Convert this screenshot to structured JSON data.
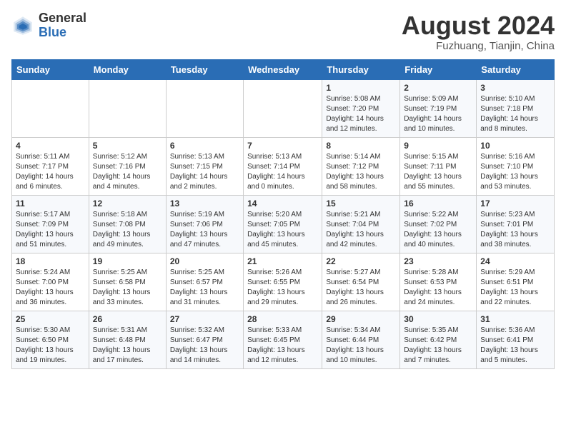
{
  "logo": {
    "general": "General",
    "blue": "Blue"
  },
  "title": {
    "month_year": "August 2024",
    "location": "Fuzhuang, Tianjin, China"
  },
  "headers": [
    "Sunday",
    "Monday",
    "Tuesday",
    "Wednesday",
    "Thursday",
    "Friday",
    "Saturday"
  ],
  "weeks": [
    [
      {
        "day": "",
        "detail": ""
      },
      {
        "day": "",
        "detail": ""
      },
      {
        "day": "",
        "detail": ""
      },
      {
        "day": "",
        "detail": ""
      },
      {
        "day": "1",
        "detail": "Sunrise: 5:08 AM\nSunset: 7:20 PM\nDaylight: 14 hours\nand 12 minutes."
      },
      {
        "day": "2",
        "detail": "Sunrise: 5:09 AM\nSunset: 7:19 PM\nDaylight: 14 hours\nand 10 minutes."
      },
      {
        "day": "3",
        "detail": "Sunrise: 5:10 AM\nSunset: 7:18 PM\nDaylight: 14 hours\nand 8 minutes."
      }
    ],
    [
      {
        "day": "4",
        "detail": "Sunrise: 5:11 AM\nSunset: 7:17 PM\nDaylight: 14 hours\nand 6 minutes."
      },
      {
        "day": "5",
        "detail": "Sunrise: 5:12 AM\nSunset: 7:16 PM\nDaylight: 14 hours\nand 4 minutes."
      },
      {
        "day": "6",
        "detail": "Sunrise: 5:13 AM\nSunset: 7:15 PM\nDaylight: 14 hours\nand 2 minutes."
      },
      {
        "day": "7",
        "detail": "Sunrise: 5:13 AM\nSunset: 7:14 PM\nDaylight: 14 hours\nand 0 minutes."
      },
      {
        "day": "8",
        "detail": "Sunrise: 5:14 AM\nSunset: 7:12 PM\nDaylight: 13 hours\nand 58 minutes."
      },
      {
        "day": "9",
        "detail": "Sunrise: 5:15 AM\nSunset: 7:11 PM\nDaylight: 13 hours\nand 55 minutes."
      },
      {
        "day": "10",
        "detail": "Sunrise: 5:16 AM\nSunset: 7:10 PM\nDaylight: 13 hours\nand 53 minutes."
      }
    ],
    [
      {
        "day": "11",
        "detail": "Sunrise: 5:17 AM\nSunset: 7:09 PM\nDaylight: 13 hours\nand 51 minutes."
      },
      {
        "day": "12",
        "detail": "Sunrise: 5:18 AM\nSunset: 7:08 PM\nDaylight: 13 hours\nand 49 minutes."
      },
      {
        "day": "13",
        "detail": "Sunrise: 5:19 AM\nSunset: 7:06 PM\nDaylight: 13 hours\nand 47 minutes."
      },
      {
        "day": "14",
        "detail": "Sunrise: 5:20 AM\nSunset: 7:05 PM\nDaylight: 13 hours\nand 45 minutes."
      },
      {
        "day": "15",
        "detail": "Sunrise: 5:21 AM\nSunset: 7:04 PM\nDaylight: 13 hours\nand 42 minutes."
      },
      {
        "day": "16",
        "detail": "Sunrise: 5:22 AM\nSunset: 7:02 PM\nDaylight: 13 hours\nand 40 minutes."
      },
      {
        "day": "17",
        "detail": "Sunrise: 5:23 AM\nSunset: 7:01 PM\nDaylight: 13 hours\nand 38 minutes."
      }
    ],
    [
      {
        "day": "18",
        "detail": "Sunrise: 5:24 AM\nSunset: 7:00 PM\nDaylight: 13 hours\nand 36 minutes."
      },
      {
        "day": "19",
        "detail": "Sunrise: 5:25 AM\nSunset: 6:58 PM\nDaylight: 13 hours\nand 33 minutes."
      },
      {
        "day": "20",
        "detail": "Sunrise: 5:25 AM\nSunset: 6:57 PM\nDaylight: 13 hours\nand 31 minutes."
      },
      {
        "day": "21",
        "detail": "Sunrise: 5:26 AM\nSunset: 6:55 PM\nDaylight: 13 hours\nand 29 minutes."
      },
      {
        "day": "22",
        "detail": "Sunrise: 5:27 AM\nSunset: 6:54 PM\nDaylight: 13 hours\nand 26 minutes."
      },
      {
        "day": "23",
        "detail": "Sunrise: 5:28 AM\nSunset: 6:53 PM\nDaylight: 13 hours\nand 24 minutes."
      },
      {
        "day": "24",
        "detail": "Sunrise: 5:29 AM\nSunset: 6:51 PM\nDaylight: 13 hours\nand 22 minutes."
      }
    ],
    [
      {
        "day": "25",
        "detail": "Sunrise: 5:30 AM\nSunset: 6:50 PM\nDaylight: 13 hours\nand 19 minutes."
      },
      {
        "day": "26",
        "detail": "Sunrise: 5:31 AM\nSunset: 6:48 PM\nDaylight: 13 hours\nand 17 minutes."
      },
      {
        "day": "27",
        "detail": "Sunrise: 5:32 AM\nSunset: 6:47 PM\nDaylight: 13 hours\nand 14 minutes."
      },
      {
        "day": "28",
        "detail": "Sunrise: 5:33 AM\nSunset: 6:45 PM\nDaylight: 13 hours\nand 12 minutes."
      },
      {
        "day": "29",
        "detail": "Sunrise: 5:34 AM\nSunset: 6:44 PM\nDaylight: 13 hours\nand 10 minutes."
      },
      {
        "day": "30",
        "detail": "Sunrise: 5:35 AM\nSunset: 6:42 PM\nDaylight: 13 hours\nand 7 minutes."
      },
      {
        "day": "31",
        "detail": "Sunrise: 5:36 AM\nSunset: 6:41 PM\nDaylight: 13 hours\nand 5 minutes."
      }
    ]
  ]
}
